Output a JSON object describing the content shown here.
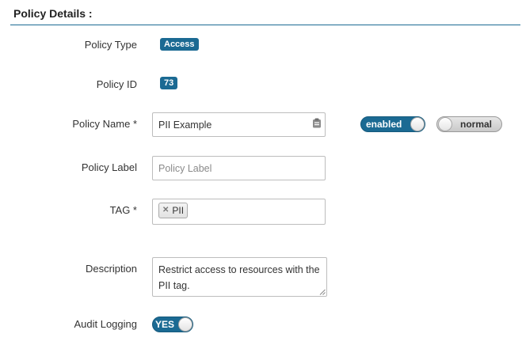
{
  "section": {
    "title": "Policy Details :"
  },
  "policy_type": {
    "label": "Policy Type",
    "value": "Access"
  },
  "policy_id": {
    "label": "Policy ID",
    "value": "73"
  },
  "policy_name": {
    "label": "Policy Name *",
    "value": "PII Example",
    "icon": "clipboard-icon",
    "enabled_toggle_label": "enabled",
    "mode_toggle_label": "normal"
  },
  "policy_label": {
    "label": "Policy Label",
    "placeholder": "Policy Label"
  },
  "tag": {
    "label": "TAG *",
    "chips": [
      "PII"
    ]
  },
  "description": {
    "label": "Description",
    "value": "Restrict access to resources with the PII tag."
  },
  "audit_logging": {
    "label": "Audit Logging",
    "toggle_label": "YES"
  },
  "colors": {
    "accent": "#1b6a93"
  }
}
